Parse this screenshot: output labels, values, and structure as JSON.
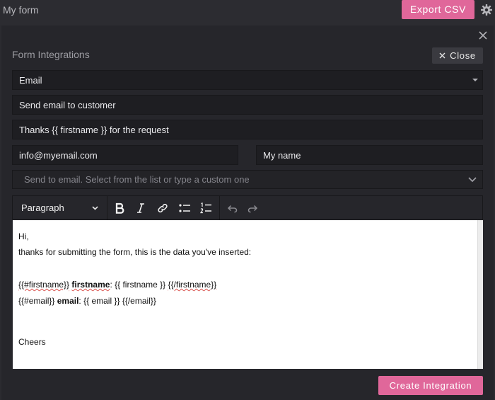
{
  "app": {
    "title": "My form",
    "export_label": "Export CSV"
  },
  "panel": {
    "title": "Form Integrations",
    "close_label": "Close"
  },
  "form": {
    "integration_type": "Email",
    "subject": "Send email to customer",
    "title_line": "Thanks {{ firstname }} for the request",
    "from_email": "info@myemail.com",
    "from_name": "My name",
    "send_to_placeholder": "Send to email. Select from the list or type a custom one"
  },
  "toolbar": {
    "block_style": "Paragraph"
  },
  "editor": {
    "line1": "Hi,",
    "line2": "thanks for submitting the form, this is the data you've inserted:",
    "line3": {
      "open_tag": "{{#firstname}}",
      "label": "firstname",
      "colon": ":",
      "value": "{{ firstname }}",
      "close_tag": "{{/firstname}}"
    },
    "line4": {
      "open_tag": "{{#email}}",
      "label": "email",
      "colon": ":",
      "value": "{{ email }}",
      "close_tag": "{{/email}}"
    },
    "line5": "Cheers"
  },
  "footer": {
    "create_label": "Create Integration"
  },
  "colors": {
    "accent": "#e0679a",
    "background": "#2b2b30",
    "field": "#1e1e22"
  },
  "icons": [
    "gear-icon",
    "close-icon",
    "chevron-down-icon",
    "bold-icon",
    "italic-icon",
    "link-icon",
    "bullet-list-icon",
    "numbered-list-icon",
    "undo-icon",
    "redo-icon"
  ]
}
